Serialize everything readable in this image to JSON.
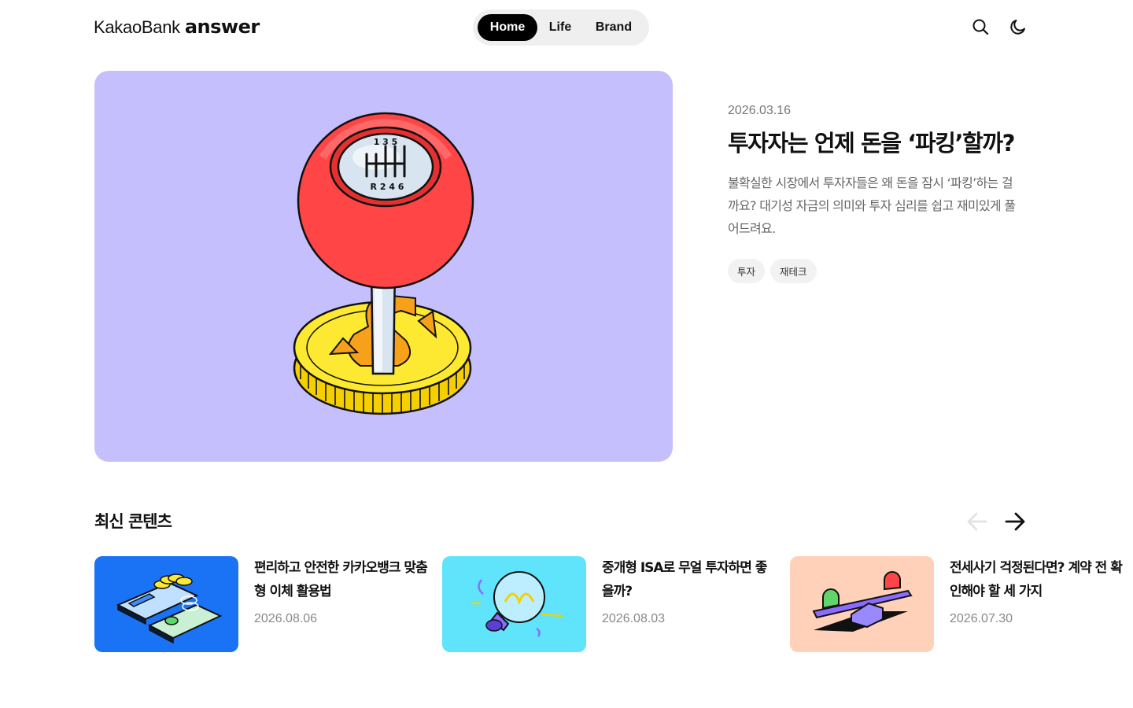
{
  "header": {
    "logo_brand": "KakaoBank",
    "logo_product": "answer",
    "nav": [
      {
        "label": "Home",
        "active": true
      },
      {
        "label": "Life",
        "active": false
      },
      {
        "label": "Brand",
        "active": false
      }
    ],
    "icons": [
      "search-icon",
      "moon-icon"
    ]
  },
  "hero": {
    "date": "2026.03.16",
    "title": "투자자는 언제 돈을 ‘파킹’할까?",
    "description": "불확실한 시장에서 투자자들은 왜 돈을 잠시 ‘파킹’하는 걸까요? 대기성 자금의 의미와 투자 심리를 쉽고 재미있게 풀어드려요.",
    "tags": [
      "투자",
      "재테크"
    ],
    "image_bg": "#c6bffd",
    "shifter_numbers_top": "1 3 5",
    "shifter_numbers_bottom": "R 2 4 6"
  },
  "latest": {
    "title": "최신 콘텐츠",
    "cards": [
      {
        "title": "편리하고 안전한 카카오뱅크 맞춤형 이체 활용법",
        "date": "2026.08.06",
        "thumb_bg": "#1a73f5"
      },
      {
        "title": "중개형 ISA로 무얼 투자하면 좋을까?",
        "date": "2026.08.03",
        "thumb_bg": "#5fe4fb"
      },
      {
        "title": "전세사기 걱정된다면? 계약 전 확인해야 할 세 가지",
        "date": "2026.07.30",
        "thumb_bg": "#ffd1b8"
      }
    ]
  }
}
